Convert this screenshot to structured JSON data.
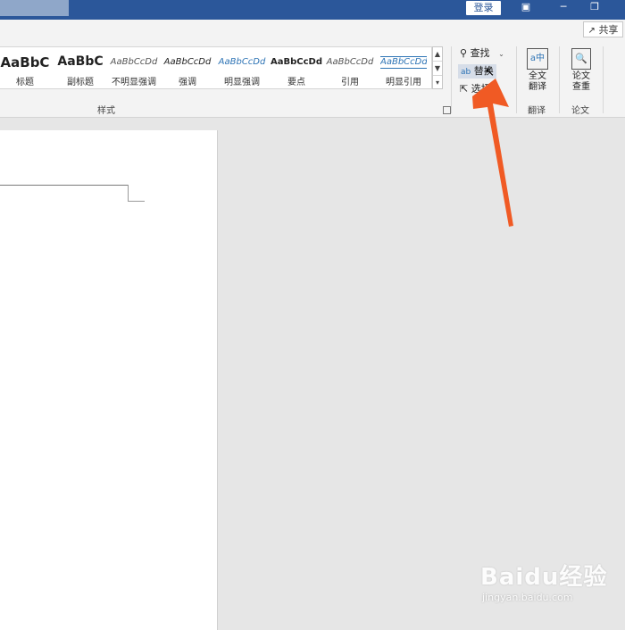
{
  "titlebar": {
    "login_label": "登录",
    "restore_icon": "ribbon-display-icon",
    "minimize_icon": "minimize-icon",
    "maximize_icon": "restore-window-icon"
  },
  "ribbon": {
    "share_label": "共享",
    "styles": [
      {
        "sample": "AaBbC",
        "name": "标题"
      },
      {
        "sample": "AaBbC",
        "name": "副标题"
      },
      {
        "sample": "AaBbCcDd",
        "name": "不明显强调"
      },
      {
        "sample": "AaBbCcDd",
        "name": "强调"
      },
      {
        "sample": "AaBbCcDd",
        "name": "明显强调"
      },
      {
        "sample": "AaBbCcDd",
        "name": "要点"
      },
      {
        "sample": "AaBbCcDd",
        "name": "引用"
      },
      {
        "sample": "AaBbCcDd",
        "name": "明显引用"
      }
    ],
    "styles_group_label": "样式",
    "editing": {
      "find": "查找",
      "replace": "替换",
      "select": "选择"
    },
    "translate": {
      "button": "全文\n翻译",
      "group": "翻译"
    },
    "paper": {
      "button": "论文\n查重",
      "group": "论文"
    }
  },
  "colors": {
    "accent": "#2b579a",
    "arrow": "#f05a24"
  },
  "watermark": {
    "logo": "Baidu经验",
    "url": "jingyan.baidu.com"
  }
}
